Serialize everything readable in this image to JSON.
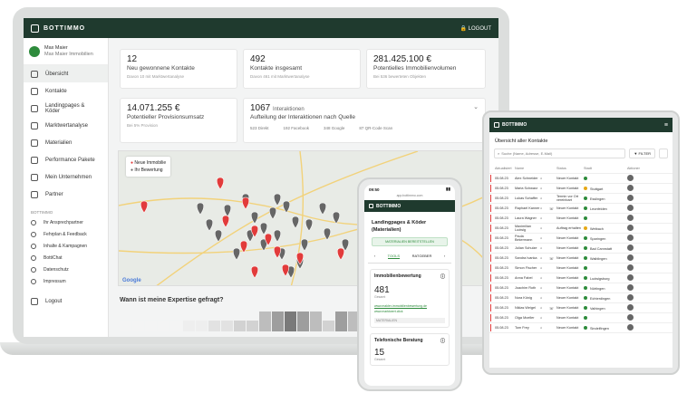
{
  "app": {
    "brand": "BOTTIMMO",
    "logout": "LOGOUT"
  },
  "user": {
    "name": "Max Maier",
    "company": "Max Maier Immobilien"
  },
  "sidebar": {
    "items": [
      {
        "label": "Übersicht",
        "active": true
      },
      {
        "label": "Kontakte"
      },
      {
        "label": "Landingpages & Köder"
      },
      {
        "label": "Marktwertanalyse"
      },
      {
        "label": "Materialien"
      },
      {
        "label": "Performance Pakete"
      },
      {
        "label": "Mein Unternehmen"
      },
      {
        "label": "Partner"
      }
    ],
    "section": "BOTTIMMO",
    "sub_items": [
      {
        "label": "Ihr Ansprechpartner"
      },
      {
        "label": "Fehrplan & Feedback"
      },
      {
        "label": "Inhalte & Kampagnen"
      },
      {
        "label": "BottiChat"
      },
      {
        "label": "Datenschutz"
      },
      {
        "label": "Impressum"
      }
    ],
    "logout": "Logout"
  },
  "stats": [
    {
      "value": "12",
      "label": "Neu gewonnene Kontakte",
      "sub": "Davon 10 mit Marktwertanalyse"
    },
    {
      "value": "492",
      "label": "Kontakte insgesamt",
      "sub": "Davon 461 mit Marktwertanalyse"
    },
    {
      "value": "281.425.100 €",
      "label": "Potentielles Immobilienvolumen",
      "sub": "Bei 536 bewerteten Objekten"
    },
    {
      "value": "14.071.255 €",
      "label": "Potentieller Provisionsumsatz",
      "sub": "Bei 5% Provision"
    }
  ],
  "interactions": {
    "value": "1067",
    "value_label": "Interaktionen",
    "title": "Aufteilung der Interaktionen nach Quelle",
    "sources": [
      "523 Direkt",
      "192 Facebook",
      "348 Google",
      "87 QR-Code Scan"
    ]
  },
  "map": {
    "legend_new": "Neue Immobilie",
    "legend_eval": "Ihr Bewertung",
    "google": "Google"
  },
  "question": "Wann ist meine Expertise gefragt?",
  "phone": {
    "time": "09:50",
    "url": "app.bottimmo.com",
    "brand": "BOTTIMMO",
    "title": "Landingpages & Köder (Materialien)",
    "button": "MATERIALIEN BEREITSTELLEN",
    "tab_tools": "TOOLS",
    "tab_ratgeber": "RATGEBER",
    "section1": "Immobilienbewertung",
    "count1": "481",
    "count1_label": "Gesamt",
    "link1": "www.makler-immobilienbewertung.de",
    "link2": "www.marktwert.click",
    "mat": "MATERIALIEN",
    "section2": "Telefonische Beratung",
    "count2": "15",
    "count2_label": "Gesamt"
  },
  "tablet": {
    "brand": "BOTTIMMO",
    "title": "Übersicht aller Kontakte",
    "search": "Suche (Name, Adresse, E-Mail)",
    "filter": "FILTER",
    "headers": [
      "Aktualisiert",
      "Name",
      "",
      "",
      "Status",
      "Stadt",
      "Aktionen"
    ],
    "rows": [
      {
        "date": "05.08.23",
        "name": "Alex Schneider",
        "status": "Neuer Kontakt",
        "city": "",
        "color": "#2e8b3c"
      },
      {
        "date": "05.08.23",
        "name": "Maria Schwarz",
        "status": "Neuer Kontakt",
        "city": "Stuttgart",
        "color": "#e6a817"
      },
      {
        "date": "05.08.23",
        "name": "Lukas Schaffer",
        "status": "Termin vor Ort vereinbart",
        "city": "Esslingen",
        "color": "#2e8b3c"
      },
      {
        "date": "05.08.23",
        "name": "Raphael Kanner",
        "status": "Neuer Kontakt",
        "city": "Leonfelden",
        "color": "#2e8b3c"
      },
      {
        "date": "05.08.23",
        "name": "Laura Wagner",
        "status": "Neuer Kontakt",
        "city": "",
        "color": "#2e8b3c"
      },
      {
        "date": "05.08.23",
        "name": "Maximilian Ludwig",
        "status": "Auftrag erhalten",
        "city": "Wetbach",
        "color": "#e6a817"
      },
      {
        "date": "05.08.23",
        "name": "Paula Bekermann",
        "status": "Neuer Kontakt",
        "city": "Sparingen",
        "color": "#2e8b3c"
      },
      {
        "date": "05.08.23",
        "name": "Julian Schulze",
        "status": "Neuer Kontakt",
        "city": "Bad Cannstatt",
        "color": "#2e8b3c"
      },
      {
        "date": "05.08.23",
        "name": "Sandra Ivanka",
        "status": "Neuer Kontakt",
        "city": "Waiblingen",
        "color": "#2e8b3c"
      },
      {
        "date": "05.08.23",
        "name": "Simon Fischer",
        "status": "Neuer Kontakt",
        "city": "",
        "color": "#2e8b3c"
      },
      {
        "date": "05.08.23",
        "name": "Anna Fabel",
        "status": "Neuer Kontakt",
        "city": "Ludwigsburg",
        "color": "#2e8b3c"
      },
      {
        "date": "05.08.23",
        "name": "Joachim Roth",
        "status": "Neuer Kontakt",
        "city": "Nürtingen",
        "color": "#2e8b3c"
      },
      {
        "date": "05.08.23",
        "name": "Nora König",
        "status": "Neuer Kontakt",
        "city": "Echterdingen",
        "color": "#2e8b3c"
      },
      {
        "date": "05.08.23",
        "name": "Niklas Weigel",
        "status": "Neuer Kontakt",
        "city": "Vaihingen",
        "color": "#2e8b3c"
      },
      {
        "date": "05.08.23",
        "name": "Olga Moeller",
        "status": "Neuer Kontakt",
        "city": "",
        "color": "#2e8b3c"
      },
      {
        "date": "05.08.23",
        "name": "Tom Frey",
        "status": "Neuer Kontakt",
        "city": "Sindelfingen",
        "color": "#2e8b3c"
      }
    ]
  },
  "colors": {
    "brand": "#1f3a2e",
    "accent": "#2e8b3c",
    "pin_new": "#e23b3b",
    "pin_eval": "#666666"
  }
}
